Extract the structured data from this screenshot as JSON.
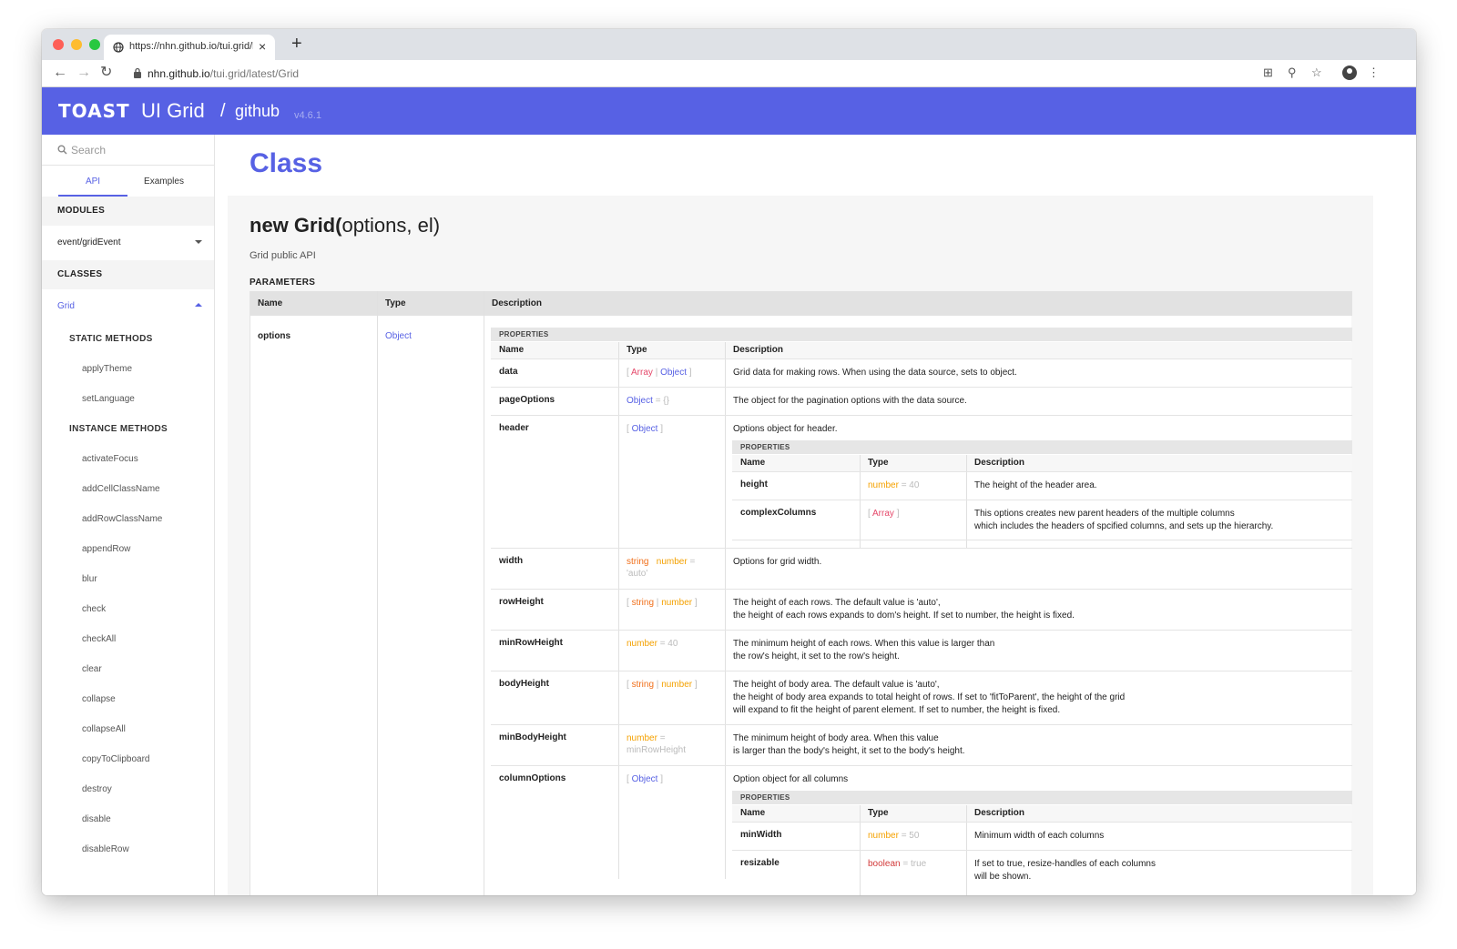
{
  "browser": {
    "tab_title": "https://nhn.github.io/tui.grid/latest/Grid",
    "tab_close": "×",
    "new_tab": "+",
    "url_host": "nhn.github.io",
    "url_path": "/tui.grid/latest/Grid",
    "back": "←",
    "forward": "→",
    "reload": "↻",
    "translate": "⊞",
    "zoom": "⚲",
    "bookmark": "☆",
    "menu": "⋮"
  },
  "header": {
    "brand": "TOAST",
    "product": "UI Grid",
    "separator": "/",
    "github": "github",
    "version": "v4.6.1"
  },
  "sidebar": {
    "search_placeholder": "Search",
    "tabs": [
      "API",
      "Examples"
    ],
    "modules_label": "MODULES",
    "module_item": "event/gridEvent",
    "classes_label": "CLASSES",
    "class_item": "Grid",
    "static_label": "STATIC METHODS",
    "static_methods": [
      "applyTheme",
      "setLanguage"
    ],
    "instance_label": "INSTANCE METHODS",
    "instance_methods": [
      "activateFocus",
      "addCellClassName",
      "addRowClassName",
      "appendRow",
      "blur",
      "check",
      "checkAll",
      "clear",
      "collapse",
      "collapseAll",
      "copyToClipboard",
      "destroy",
      "disable",
      "disableRow"
    ]
  },
  "main": {
    "title": "Class",
    "sig_name": "new Grid(",
    "sig_args": "options, el)",
    "description": "Grid public API",
    "params_label": "PARAMETERS",
    "columns": [
      "Name",
      "Type",
      "Description"
    ],
    "param_name": "options",
    "param_type": "Object",
    "properties_label": "PROPERTIES",
    "props": {
      "data": {
        "name": "data",
        "t1": "Array",
        "sep": "|",
        "t2": "Object",
        "desc": "Grid data for making rows. When using the data source, sets to object."
      },
      "pageOptions": {
        "name": "pageOptions",
        "t1": "Object",
        "def": "= {}",
        "desc": "The object for the pagination options with the data source."
      },
      "header": {
        "name": "header",
        "t1": "Object",
        "desc": "Options object for header."
      },
      "width": {
        "name": "width",
        "t1": "string",
        "t2": "number",
        "def": "=",
        "def2": "'auto'",
        "desc": "Options for grid width."
      },
      "rowHeight": {
        "name": "rowHeight",
        "t1": "string",
        "sep": "|",
        "t2": "number",
        "desc1": "The height of each rows. The default value is 'auto',",
        "desc2": "the height of each rows expands to dom's height. If set to number, the height is fixed."
      },
      "minRowHeight": {
        "name": "minRowHeight",
        "t1": "number",
        "def": "= 40",
        "desc1": "The minimum height of each rows. When this value is larger than",
        "desc2": "the row's height, it set to the row's height."
      },
      "bodyHeight": {
        "name": "bodyHeight",
        "t1": "string",
        "sep": "|",
        "t2": "number",
        "desc1": "The height of body area. The default value is 'auto',",
        "desc2": "the height of body area expands to total height of rows. If set to 'fitToParent', the height of the grid",
        "desc3": "will expand to fit the height of parent element. If set to number, the height is fixed."
      },
      "minBodyHeight": {
        "name": "minBodyHeight",
        "t1": "number",
        "def": "=",
        "def2": "minRowHeight",
        "desc1": "The minimum height of body area. When this value",
        "desc2": "is larger than the body's height, it set to the body's height."
      },
      "columnOptions": {
        "name": "columnOptions",
        "t1": "Object",
        "desc": "Option object for all columns"
      }
    },
    "header_props": {
      "height": {
        "name": "height",
        "t1": "number",
        "def": "= 40",
        "desc": "The height of the header area."
      },
      "complexColumns": {
        "name": "complexColumns",
        "t1": "Array",
        "desc1": "This options creates new parent headers of the multiple columns",
        "desc2": "which includes the headers of spcified columns, and sets up the hierarchy."
      }
    },
    "column_props": {
      "minWidth": {
        "name": "minWidth",
        "t1": "number",
        "def": "= 50",
        "desc": "Minimum width of each columns"
      },
      "resizable": {
        "name": "resizable",
        "t1": "boolean",
        "def": "= true",
        "desc1": "If set to true, resize-handles of each columns",
        "desc2": "will be shown."
      }
    },
    "bracket_open": "[",
    "bracket_close": "]"
  }
}
